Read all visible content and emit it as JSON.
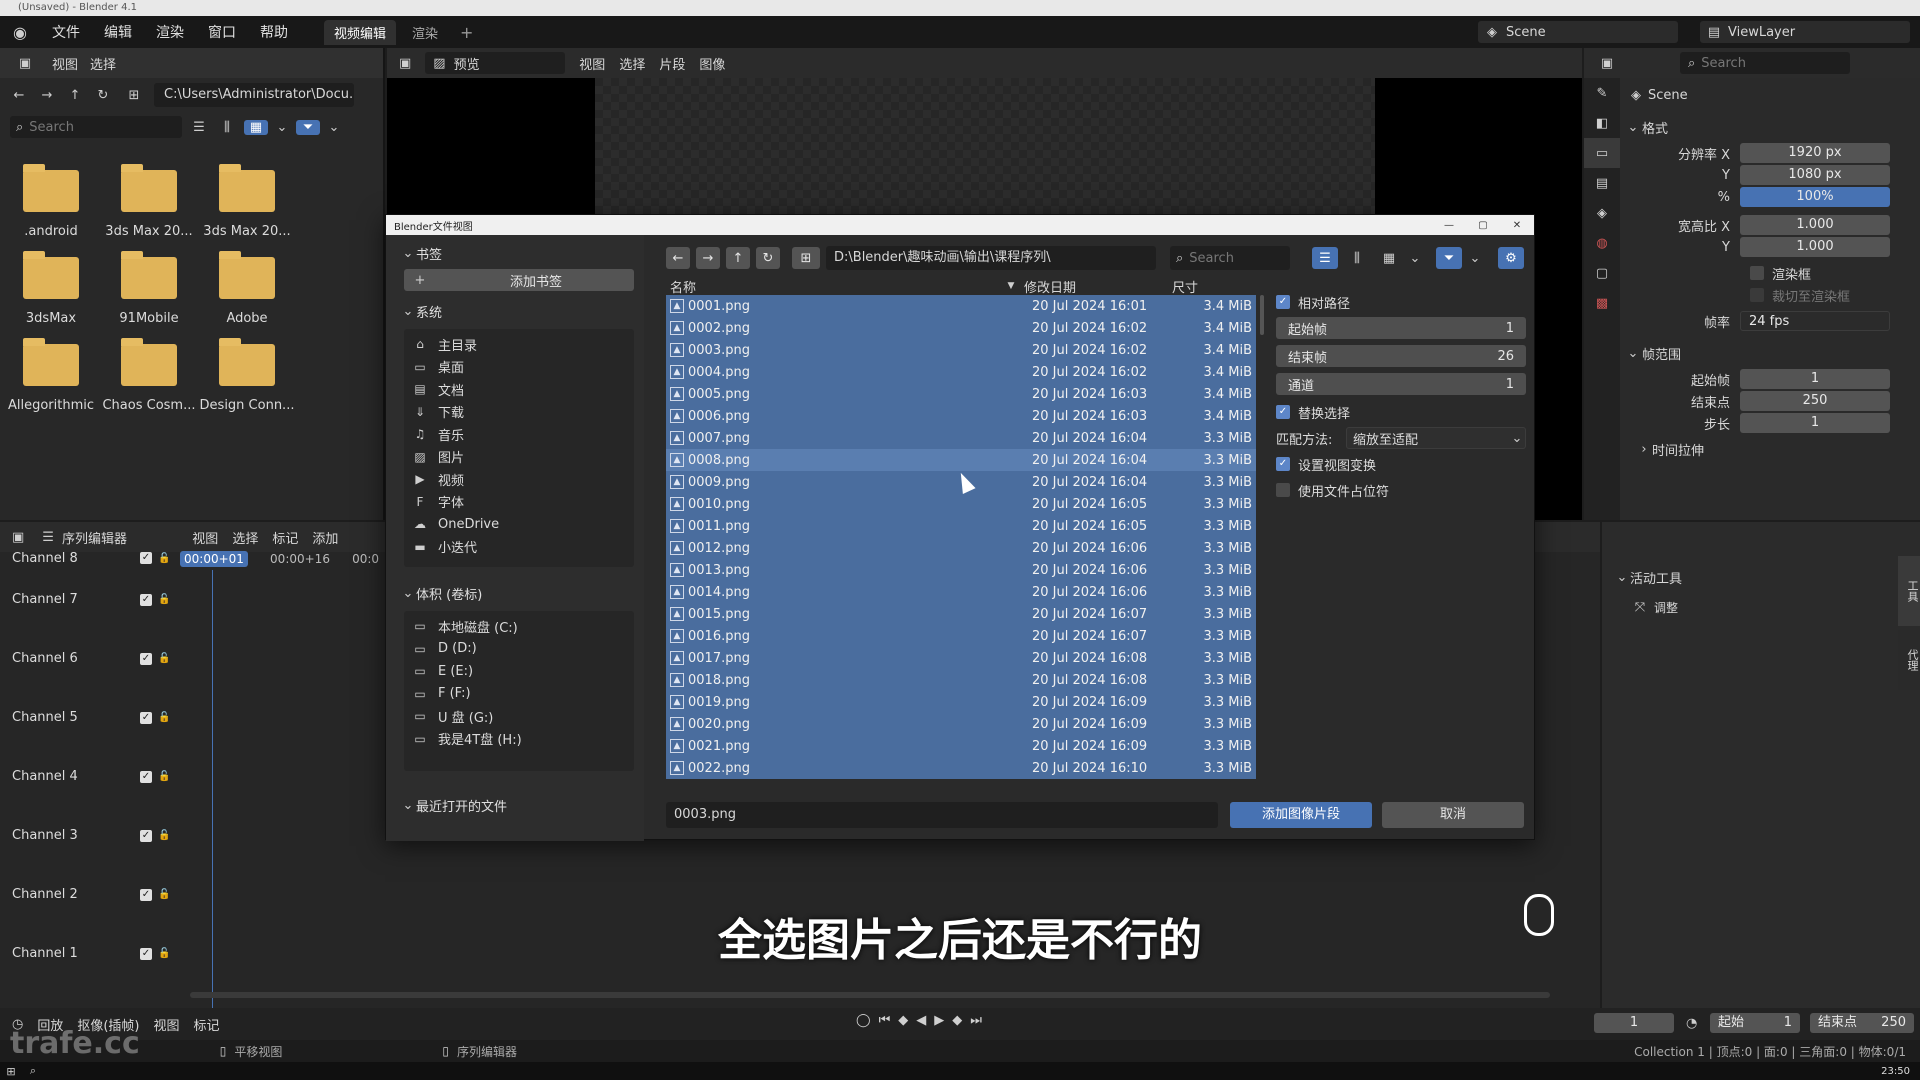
{
  "titlebar": {
    "text": "(Unsaved) - Blender 4.1"
  },
  "menu": {
    "items": [
      "文件",
      "编辑",
      "渲染",
      "窗口",
      "帮助"
    ],
    "tabs": [
      "视频编辑",
      "渲染"
    ],
    "add": "+"
  },
  "topright": {
    "scene": "Scene",
    "viewlayer": "ViewLayer"
  },
  "leftfb": {
    "menu": [
      "视图",
      "选择"
    ],
    "path": "C:\\Users\\Administrator\\Docu...",
    "search_placeholder": "Search",
    "folders": [
      ".android",
      "3ds Max 20...",
      "3ds Max 20...",
      "3dsMax",
      "91Mobile",
      "Adobe",
      "Allegorithmic",
      "Chaos Cosm...",
      "Design Conn..."
    ]
  },
  "preview_header": {
    "mode": "预览",
    "menu": [
      "视图",
      "选择",
      "片段",
      "图像"
    ]
  },
  "props": {
    "search_placeholder": "Search",
    "scene": "Scene",
    "format_label": "格式",
    "res_x_label": "分辨率 X",
    "res_x": "1920 px",
    "res_y_label": "Y",
    "res_y": "1080 px",
    "pct_label": "%",
    "pct": "100%",
    "aspect_x_label": "宽高比 X",
    "aspect_x": "1.000",
    "aspect_y_label": "Y",
    "aspect_y": "1.000",
    "render_region": "渲染框",
    "crop": "裁切至渲染框",
    "fps_label": "帧率",
    "fps": "24 fps",
    "frame_range_label": "帧范围",
    "start_label": "起始帧",
    "start": "1",
    "end_label": "结束点",
    "end": "250",
    "step_label": "步长",
    "step": "1",
    "time_stretch": "时间拉伸"
  },
  "seq": {
    "editor": "序列编辑器",
    "menu": [
      "视图",
      "选择",
      "标记",
      "添加"
    ],
    "timecode": "00:00+01",
    "ticks": [
      "00:00+16",
      "00:0"
    ],
    "channels": [
      "Channel 8",
      "Channel 7",
      "Channel 6",
      "Channel 5",
      "Channel 4",
      "Channel 3",
      "Channel 2",
      "Channel 1"
    ]
  },
  "tools": {
    "title": "活动工具",
    "tool": "调整",
    "side_tabs": [
      "工具",
      "代理"
    ]
  },
  "timeline": {
    "menu": [
      "回放",
      "抠像(插帧)",
      "视图",
      "标记"
    ],
    "frame": "1",
    "start_label": "起始",
    "start": "1",
    "end_label": "结束点",
    "end": "250"
  },
  "status": {
    "pan": "平移视图",
    "seq": "序列编辑器",
    "info": "Collection 1 | 顶点:0 | 面:0 | 三角面:0 | 物体:0/1",
    "watermark": "trafe.cc"
  },
  "taskbar": {
    "time": "23:50"
  },
  "dialog": {
    "title": "Blender文件视图",
    "path": "D:\\Blender\\趣味动画\\输出\\课程序列\\",
    "search_placeholder": "Search",
    "bookmarks_label": "书签",
    "add_bookmark": "添加书签",
    "system_label": "系统",
    "system": [
      {
        "icon": "home-icon",
        "label": "主目录"
      },
      {
        "icon": "desktop-icon",
        "label": "桌面"
      },
      {
        "icon": "document-icon",
        "label": "文档"
      },
      {
        "icon": "download-icon",
        "label": "下载"
      },
      {
        "icon": "music-icon",
        "label": "音乐"
      },
      {
        "icon": "image-icon",
        "label": "图片"
      },
      {
        "icon": "video-icon",
        "label": "视频"
      },
      {
        "icon": "font-icon",
        "label": "字体"
      },
      {
        "icon": "cloud-icon",
        "label": "OneDrive"
      },
      {
        "icon": "folder-icon",
        "label": "小迭代"
      }
    ],
    "volumes_label": "体积 (卷标)",
    "volumes": [
      "本地磁盘 (C:)",
      "D (D:)",
      "E (E:)",
      "F (F:)",
      "U 盘 (G:)",
      "我是4T盘 (H:)"
    ],
    "recent_label": "最近打开的文件",
    "columns": {
      "name": "名称",
      "date": "修改日期",
      "size": "尺寸"
    },
    "files": [
      {
        "name": "0001.png",
        "date": "20 Jul 2024 16:01",
        "size": "3.4 MiB"
      },
      {
        "name": "0002.png",
        "date": "20 Jul 2024 16:02",
        "size": "3.4 MiB"
      },
      {
        "name": "0003.png",
        "date": "20 Jul 2024 16:02",
        "size": "3.4 MiB"
      },
      {
        "name": "0004.png",
        "date": "20 Jul 2024 16:02",
        "size": "3.4 MiB"
      },
      {
        "name": "0005.png",
        "date": "20 Jul 2024 16:03",
        "size": "3.4 MiB"
      },
      {
        "name": "0006.png",
        "date": "20 Jul 2024 16:03",
        "size": "3.4 MiB"
      },
      {
        "name": "0007.png",
        "date": "20 Jul 2024 16:04",
        "size": "3.3 MiB"
      },
      {
        "name": "0008.png",
        "date": "20 Jul 2024 16:04",
        "size": "3.3 MiB"
      },
      {
        "name": "0009.png",
        "date": "20 Jul 2024 16:04",
        "size": "3.3 MiB"
      },
      {
        "name": "0010.png",
        "date": "20 Jul 2024 16:05",
        "size": "3.3 MiB"
      },
      {
        "name": "0011.png",
        "date": "20 Jul 2024 16:05",
        "size": "3.3 MiB"
      },
      {
        "name": "0012.png",
        "date": "20 Jul 2024 16:06",
        "size": "3.3 MiB"
      },
      {
        "name": "0013.png",
        "date": "20 Jul 2024 16:06",
        "size": "3.3 MiB"
      },
      {
        "name": "0014.png",
        "date": "20 Jul 2024 16:06",
        "size": "3.3 MiB"
      },
      {
        "name": "0015.png",
        "date": "20 Jul 2024 16:07",
        "size": "3.3 MiB"
      },
      {
        "name": "0016.png",
        "date": "20 Jul 2024 16:07",
        "size": "3.3 MiB"
      },
      {
        "name": "0017.png",
        "date": "20 Jul 2024 16:08",
        "size": "3.3 MiB"
      },
      {
        "name": "0018.png",
        "date": "20 Jul 2024 16:08",
        "size": "3.3 MiB"
      },
      {
        "name": "0019.png",
        "date": "20 Jul 2024 16:09",
        "size": "3.3 MiB"
      },
      {
        "name": "0020.png",
        "date": "20 Jul 2024 16:09",
        "size": "3.3 MiB"
      },
      {
        "name": "0021.png",
        "date": "20 Jul 2024 16:09",
        "size": "3.3 MiB"
      },
      {
        "name": "0022.png",
        "date": "20 Jul 2024 16:10",
        "size": "3.3 MiB"
      }
    ],
    "options": {
      "relative_path": "相对路径",
      "start_frame_label": "起始帧",
      "start_frame": "1",
      "end_frame_label": "结束帧",
      "end_frame": "26",
      "channel_label": "通道",
      "channel": "1",
      "replace_sel": "替换选择",
      "fit_label": "匹配方法:",
      "fit": "缩放至适配",
      "set_view_transform": "设置视图变换",
      "use_placeholders": "使用文件占位符"
    },
    "filename": "0003.png",
    "confirm": "添加图像片段",
    "cancel": "取消"
  },
  "caption": "全选图片之后还是不行的"
}
